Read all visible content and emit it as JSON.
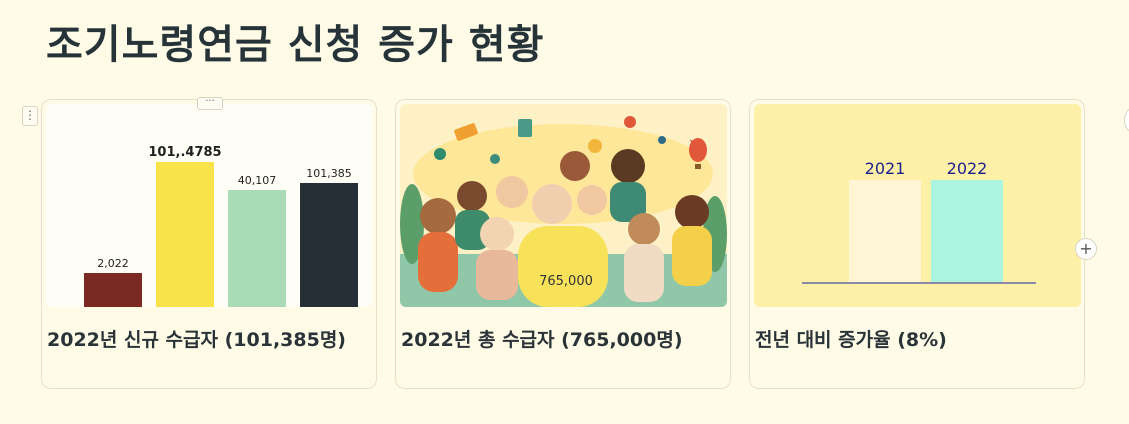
{
  "page": {
    "title": "조기노령연금 신청 증가 현황"
  },
  "controls": {
    "drag_handle": "⋮",
    "menu": "···",
    "add": "+"
  },
  "cards": [
    {
      "caption": "2022년 신규 수급자 (101,385명)",
      "chart_data": {
        "type": "bar",
        "title": "",
        "xlabel": "",
        "ylabel": "",
        "data_labels": [
          "2,022",
          "101,.4785",
          "40,107",
          "101,385"
        ],
        "values": [
          2022,
          101385,
          40107,
          101385
        ],
        "colors": [
          "#7a2a22",
          "#f8e34a",
          "#a9dcb6",
          "#262f35"
        ],
        "grid": false,
        "legend": "none"
      }
    },
    {
      "caption": "2022년 총 수급자 (765,000명)",
      "illustration": {
        "label": "765,000",
        "icon": "group-of-elderly-people-illustration"
      }
    },
    {
      "caption": "전년 대비 증가율 (8%)",
      "chart_data": {
        "type": "bar",
        "title": "",
        "categories": [
          "2021",
          "2022"
        ],
        "colors": [
          "#fff6d6",
          "#abf5df"
        ],
        "grid": false,
        "legend": "none"
      }
    }
  ]
}
